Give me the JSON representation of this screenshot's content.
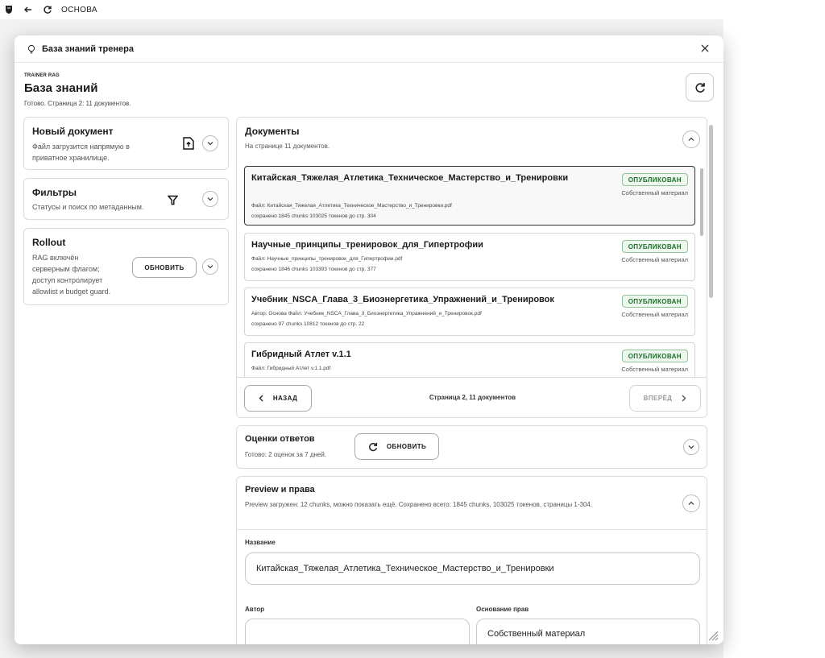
{
  "appbar": {
    "title": "ОСНОВА"
  },
  "dialog": {
    "title": "База знаний тренера"
  },
  "header": {
    "eyebrow": "TRAINER RAG",
    "title": "База знаний",
    "status": "Готово. Страница 2: 11 документов."
  },
  "new_document": {
    "title": "Новый документ",
    "desc_line1": "Файл загрузится напрямую в",
    "desc_line2": "приватное хранилище."
  },
  "filters": {
    "title": "Фильтры",
    "desc": "Статусы и поиск по метаданным."
  },
  "rollout": {
    "title": "Rollout",
    "desc_lines": [
      "RAG включён",
      "серверным флагом;",
      "доступ контролирует",
      "allowlist и budget guard."
    ],
    "refresh_label": "ОБНОВИТЬ"
  },
  "documents": {
    "title": "Документы",
    "subtitle": "На странице 11 документов.",
    "items": [
      {
        "name": "Китайская_Тяжелая_Атлетика_Техническое_Мастерство_и_Тренировки",
        "meta1": "Файл: Китайская_Тяжелая_Атлетика_Техническое_Мастерство_и_Тренировки.pdf",
        "meta2": "сохранено 1845 chunks  103025 токенов  до стр. 304",
        "status": "ОПУБЛИКОВАН",
        "source": "Собственный материал"
      },
      {
        "name": "Научные_принципы_тренировок_для_Гипертрофии",
        "meta1": "Файл: Научные_принципы_тренировок_для_Гипертрофии.pdf",
        "meta2": "сохранено 1846 chunks  103393 токенов  до стр. 377",
        "status": "ОПУБЛИКОВАН",
        "source": "Собственный материал"
      },
      {
        "name": "Учебник_NSCA_Глава_3_Биоэнергетика_Упражнений_и_Тренировок",
        "meta1": "Автор: Основа  Файл: Учебник_NSCA_Глава_3_Биоэнергетика_Упражнений_и_Тренировок.pdf",
        "meta2": "сохранено 97 chunks  10812 токенов  до стр. 22",
        "status": "ОПУБЛИКОВАН",
        "source": "Собственный материал"
      },
      {
        "name": "Гибридный Атлет v.1.1",
        "meta1": "Файл: Гибридный Атлет v.1.1.pdf",
        "meta2": "",
        "status": "ОПУБЛИКОВАН",
        "source": "Собственный материал"
      }
    ],
    "back_label": "НАЗАД",
    "page_info": "Страница 2, 11 документов",
    "next_label": "ВПЕРЁД"
  },
  "scores": {
    "title": "Оценки ответов",
    "subtitle": "Готово: 2 оценок за 7 дней.",
    "refresh_label": "ОБНОВИТЬ"
  },
  "preview": {
    "title": "Preview и права",
    "subtitle": "Preview загружен: 12 chunks, можно показать ещё. Сохранено всего: 1845 chunks, 103025 токенов, страницы 1-304.",
    "name_label": "Название",
    "name_value": "Китайская_Тяжелая_Атлетика_Техническое_Мастерство_и_Тренировки",
    "author_label": "Автор",
    "author_value": "",
    "rights_label": "Основание прав",
    "rights_value": "Собственный материал"
  },
  "colors": {
    "badge_text": "#1f6b2c",
    "badge_border": "#8fc49a",
    "badge_bg": "#eef8ef"
  }
}
